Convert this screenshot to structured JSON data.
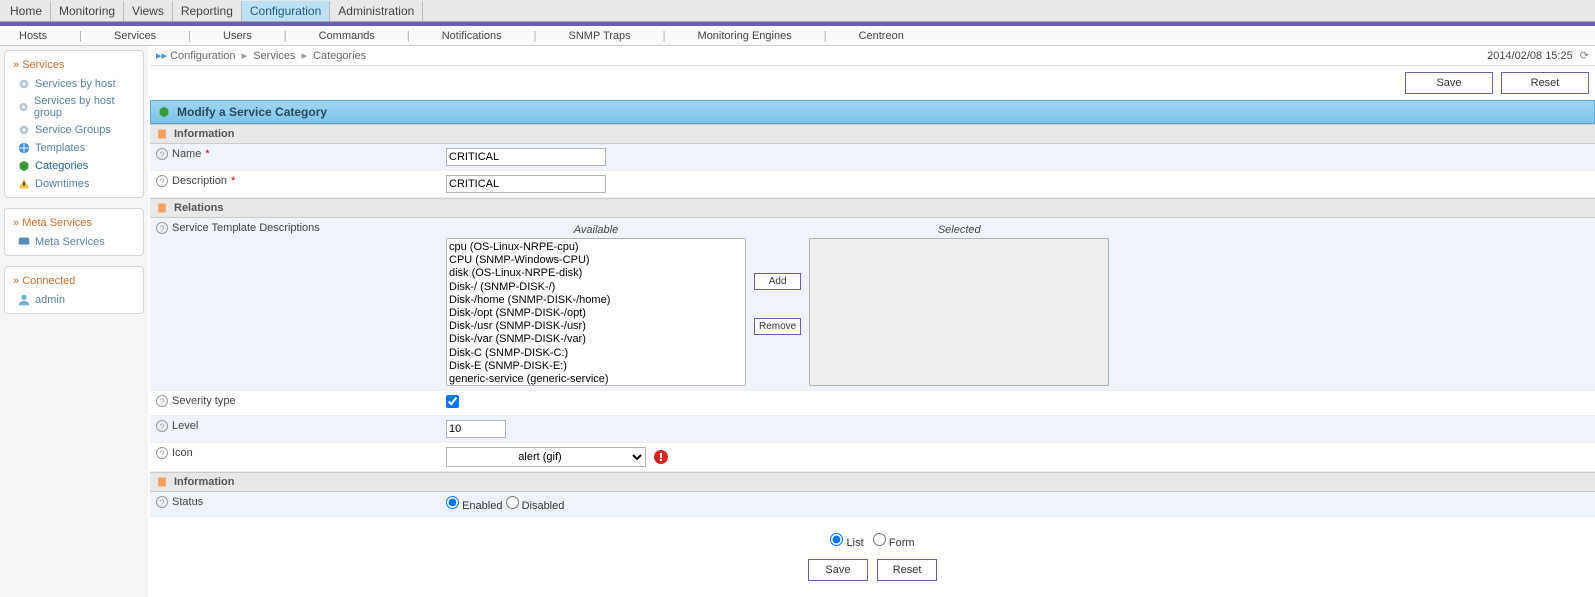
{
  "topmenu": {
    "items": [
      "Home",
      "Monitoring",
      "Views",
      "Reporting",
      "Configuration",
      "Administration"
    ],
    "active": "Configuration"
  },
  "submenu": {
    "items": [
      "Hosts",
      "Services",
      "Users",
      "Commands",
      "Notifications",
      "SNMP Traps",
      "Monitoring Engines",
      "Centreon"
    ]
  },
  "sidebar": {
    "box1_head": "Services",
    "box1_items": [
      "Services by host",
      "Services by host group",
      "Service Groups",
      "Templates",
      "Categories",
      "Downtimes"
    ],
    "box2_head": "Meta Services",
    "box2_items": [
      "Meta Services"
    ],
    "box3_head": "Connected",
    "box3_items": [
      "admin"
    ]
  },
  "breadcrumb": {
    "a": "Configuration",
    "b": "Services",
    "c": "Categories"
  },
  "timestamp": "2014/02/08 15:25",
  "buttons": {
    "save": "Save",
    "reset": "Reset",
    "add": "Add",
    "remove": "Remove"
  },
  "form": {
    "title": "Modify a Service Category",
    "sec_info": "Information",
    "sec_rel": "Relations",
    "label_name": "Name",
    "label_desc": "Description",
    "label_std": "Service Template Descriptions",
    "label_sev": "Severity type",
    "label_level": "Level",
    "label_icon": "Icon",
    "label_status": "Status",
    "name_val": "CRITICAL",
    "desc_val": "CRITICAL",
    "level_val": "10",
    "icon_val": "alert (gif)",
    "available_head": "Available",
    "selected_head": "Selected",
    "available": [
      "cpu (OS-Linux-NRPE-cpu)",
      "CPU (SNMP-Windows-CPU)",
      "disk (OS-Linux-NRPE-disk)",
      "Disk-/ (SNMP-DISK-/)",
      "Disk-/home (SNMP-DISK-/home)",
      "Disk-/opt (SNMP-DISK-/opt)",
      "Disk-/usr (SNMP-DISK-/usr)",
      "Disk-/var (SNMP-DISK-/var)",
      "Disk-C (SNMP-DISK-C:)",
      "Disk-E (SNMP-DISK-E:)",
      "generic-service (generic-service)"
    ],
    "status_enabled": "Enabled",
    "status_disabled": "Disabled",
    "view_list": "List",
    "view_form": "Form"
  }
}
